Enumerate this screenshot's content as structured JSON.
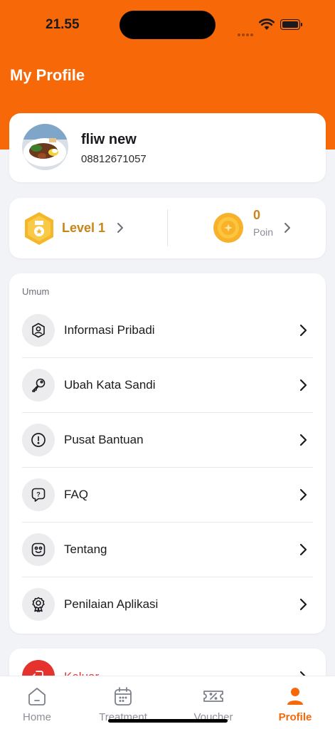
{
  "status_bar": {
    "time": "21.55"
  },
  "header": {
    "title": "My Profile"
  },
  "profile": {
    "name": "fliw new",
    "phone": "08812671057"
  },
  "rewards": {
    "level_label": "Level 1",
    "points_value": "0",
    "points_label": "Poin"
  },
  "menu": {
    "section_label": "Umum",
    "items": [
      {
        "label": "Informasi Pribadi",
        "icon": "personal-info-icon"
      },
      {
        "label": "Ubah Kata Sandi",
        "icon": "key-icon"
      },
      {
        "label": "Pusat Bantuan",
        "icon": "alert-circle-icon"
      },
      {
        "label": "FAQ",
        "icon": "question-chat-icon"
      },
      {
        "label": "Tentang",
        "icon": "smiley-icon"
      },
      {
        "label": "Penilaian Aplikasi",
        "icon": "award-icon"
      }
    ]
  },
  "logout": {
    "label": "Keluar"
  },
  "tabs": [
    {
      "label": "Home",
      "icon": "home-icon"
    },
    {
      "label": "Treatment",
      "icon": "calendar-icon"
    },
    {
      "label": "Voucher",
      "icon": "voucher-icon"
    },
    {
      "label": "Profile",
      "icon": "user-icon",
      "active": true
    }
  ],
  "colors": {
    "brand": "#f76808",
    "gold": "#c9841a",
    "danger": "#e5322d"
  }
}
